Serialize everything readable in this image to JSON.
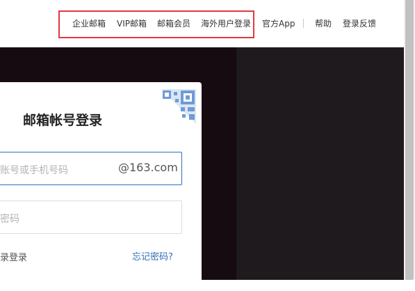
{
  "header": {
    "nav_highlighted": [
      {
        "label": "企业邮箱"
      },
      {
        "label": "VIP邮箱"
      },
      {
        "label": "邮箱会员"
      },
      {
        "label": "海外用户登录"
      }
    ],
    "official_app": "官方App",
    "help": "帮助",
    "feedback": "登录反馈"
  },
  "login": {
    "title": "邮箱帐号登录",
    "account_placeholder": "账号或手机号码",
    "domain_suffix": "@163.com",
    "password_placeholder": "密码",
    "remember_label": "录登录",
    "forgot_password": "忘记密码?"
  },
  "colors": {
    "highlight_border": "#e0393e",
    "hero_background": "#150b11",
    "link_blue": "#2f6fb5",
    "qr_accent": "#6f9bd6"
  },
  "icons": {
    "qr": "qr-code-icon"
  }
}
